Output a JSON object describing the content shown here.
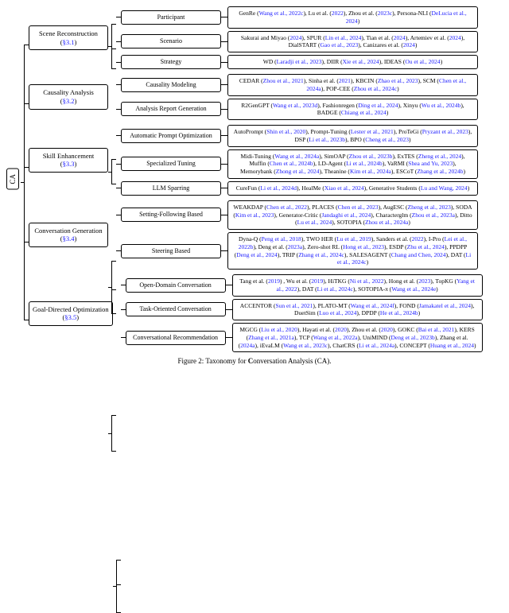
{
  "root": "CA",
  "caption_prefix": "Figure 2: Taxonomy for ",
  "caption_bold": "C",
  "caption_rest": "onversation Analysis (CA).",
  "section_prefix": "§",
  "categories": [
    {
      "name": "Scene Reconstruction",
      "section": "3.1",
      "children": [
        {
          "name": "Participant",
          "refs": "GenRe (Wang et al., 2022c), Lu et al. (2022), Zhou et al. (2023c), Persona-NLI (DeLucia et al., 2024)"
        },
        {
          "name": "Scenario",
          "refs": "Sakurai and Miyao (2024), SPUR (Lin et al., 2024), Tian et al. (2024), Artemiev et al. (2024), DialSTART (Gao et al., 2023), Canizares et al. (2024)"
        },
        {
          "name": "Strategy",
          "refs": "WD (Laradji et al., 2023), DIIR (Xie et al., 2024), IDEAS (Ou et al., 2024)"
        }
      ]
    },
    {
      "name": "Causality Analysis",
      "section": "3.2",
      "children": [
        {
          "name": "Causality Modeling",
          "refs": "CEDAR (Zhou et al., 2021), Sinha et al. (2021), KBCIN (Zhao et al., 2023), SCM (Chen et al., 2024a), POP-CEE (Zhou et al., 2024c)"
        },
        {
          "name": "Analysis Report Generation",
          "refs": "R2GenGPT (Wang et al., 2023d), Fashionregen (Ding et al., 2024), Xinyu (Wu et al., 2024b), BADGE (Chiang et al., 2024)"
        }
      ]
    },
    {
      "name": "Skill Enhancement",
      "section": "3.3",
      "children": [
        {
          "name": "Automatic Prompt Optimization",
          "refs": "AutoPrompt (Shin et al., 2020), Prompt-Tuning (Lester et al., 2021), ProTeGi (Pryzant et al., 2023), DSP (Li et al., 2023b), BPO (Cheng et al., 2023)"
        },
        {
          "name": "Specialized Tuning",
          "refs": "Midi-Tuning (Wang et al., 2024a), SimOAP (Zhou et al., 2023b), ExTES (Zheng et al., 2024), Muffin (Chen et al., 2024b), LD-Agent (Li et al., 2024b), VaRMI (Shea and Yu, 2023), Memorybank (Zhong et al., 2024), Theanine (Kim et al., 2024a), ESCoT (Zhang et al., 2024b)"
        },
        {
          "name": "LLM Sparring",
          "refs": "CureFun (Li et al., 2024d), HealMe (Xiao et al., 2024), Generative Students (Lu and Wang, 2024)"
        }
      ]
    },
    {
      "name": "Conversation Generation",
      "section": "3.4",
      "children": [
        {
          "name": "Setting-Following Based",
          "refs": "WEAKDAP (Chen et al., 2022), PLACES (Chen et al., 2023), AugESC (Zheng et al., 2023), SODA (Kim et al., 2023), Generator-Critic (Jandaghi et al., 2024), Characterglm (Zhou et al., 2023a), Ditto (Lu et al., 2024), SOTOPIA (Zhou et al., 2024a)"
        },
        {
          "name": "Steering Based",
          "refs": "Dyna-Q (Peng et al., 2018), TWO HER (Lu et al., 2019), Sanders et al. (2022), I-Pro (Lei et al., 2022b), Deng et al. (2023a), Zero-shot RL (Hong et al., 2023), ESDP (Zhu et al., 2024), PPDPP (Deng et al., 2024), TRIP (Zhang et al., 2024c), SALESAGENT (Chang and Chen, 2024), DAT (Li et al., 2024c)"
        }
      ]
    },
    {
      "name": "Goal-Directed Optimization",
      "section": "3.5",
      "children": [
        {
          "name": "Open-Domain Conversation",
          "refs": "Tang et al. (2019) , Wu et al. (2019), HiTKG (Ni et al., 2022), Hong et al. (2023), TopKG (Yang et al., 2022), DAT (Li et al., 2024c), SOTOPIA-π (Wang et al., 2024e)"
        },
        {
          "name": "Task-Oriented Conversation",
          "refs": "ACCENTOR (Sun et al., 2021), PLATO-MT (Wang et al., 2024f), FOND (Jamakatel et al., 2024), DuetSim (Luo et al., 2024), DPDP (He et al., 2024b)"
        },
        {
          "name": "Conversational Recommendation",
          "refs": "MGCG (Liu et al., 2020), Hayati et al. (2020), Zhou et al. (2020), GOKC (Bai et al., 2021), KERS (Zhang et al., 2021a), TCP (Wang et al., 2022a), UniMIND (Deng et al., 2023b), Zhang et al. (2024a), iEvaLM (Wang et al., 2023c), ChatCRS (Li et al., 2024a), CONCEPT (Huang et al., 2024)"
        }
      ]
    }
  ],
  "chart_data": {
    "type": "tree",
    "root": "CA",
    "levels": [
      "root",
      "category",
      "subtopic",
      "references"
    ],
    "node_counts": {
      "categories": 5,
      "subtopics": 13
    }
  }
}
